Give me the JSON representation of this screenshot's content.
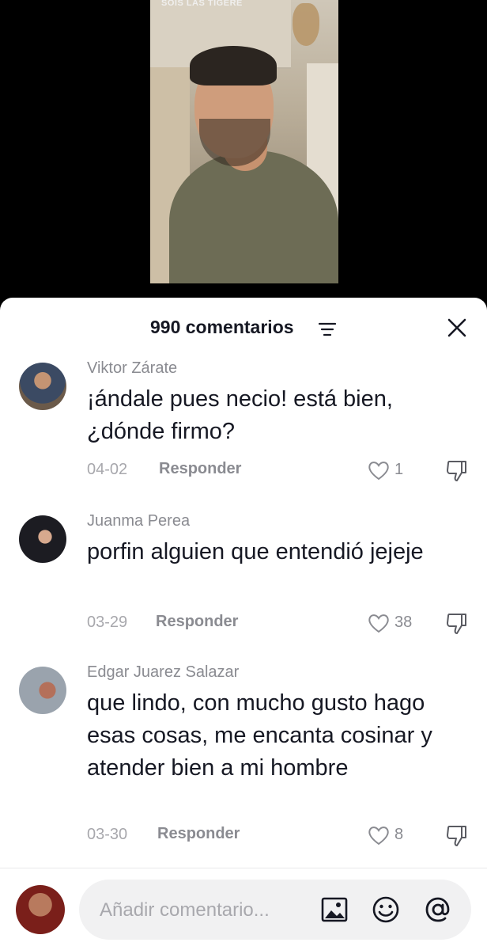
{
  "video": {
    "overlay_text": "SOIS LAS TIGERE"
  },
  "header": {
    "title": "990 comentarios",
    "filter_icon": "sort-lines-icon",
    "close_icon": "close-x-icon"
  },
  "comments": [
    {
      "username": "Viktor Zárate",
      "text": "¡ándale pues necio! está bien, ¿dónde firmo?",
      "date": "04-02",
      "reply_label": "Responder",
      "likes": "1"
    },
    {
      "username": "Juanma Perea",
      "text": "porfin alguien que entendió jejeje",
      "date": "03-29",
      "reply_label": "Responder",
      "likes": "38"
    },
    {
      "username": "Edgar Juarez Salazar",
      "text": "que lindo, con mucho gusto hago esas cosas, me encanta cosinar y atender bien a mi hombre",
      "date": "03-30",
      "reply_label": "Responder",
      "likes": "8"
    }
  ],
  "composer": {
    "placeholder": "Añadir comentario..."
  },
  "colors": {
    "text": "#161823",
    "muted": "#8a8b91",
    "input_bg": "#f1f1f2"
  }
}
